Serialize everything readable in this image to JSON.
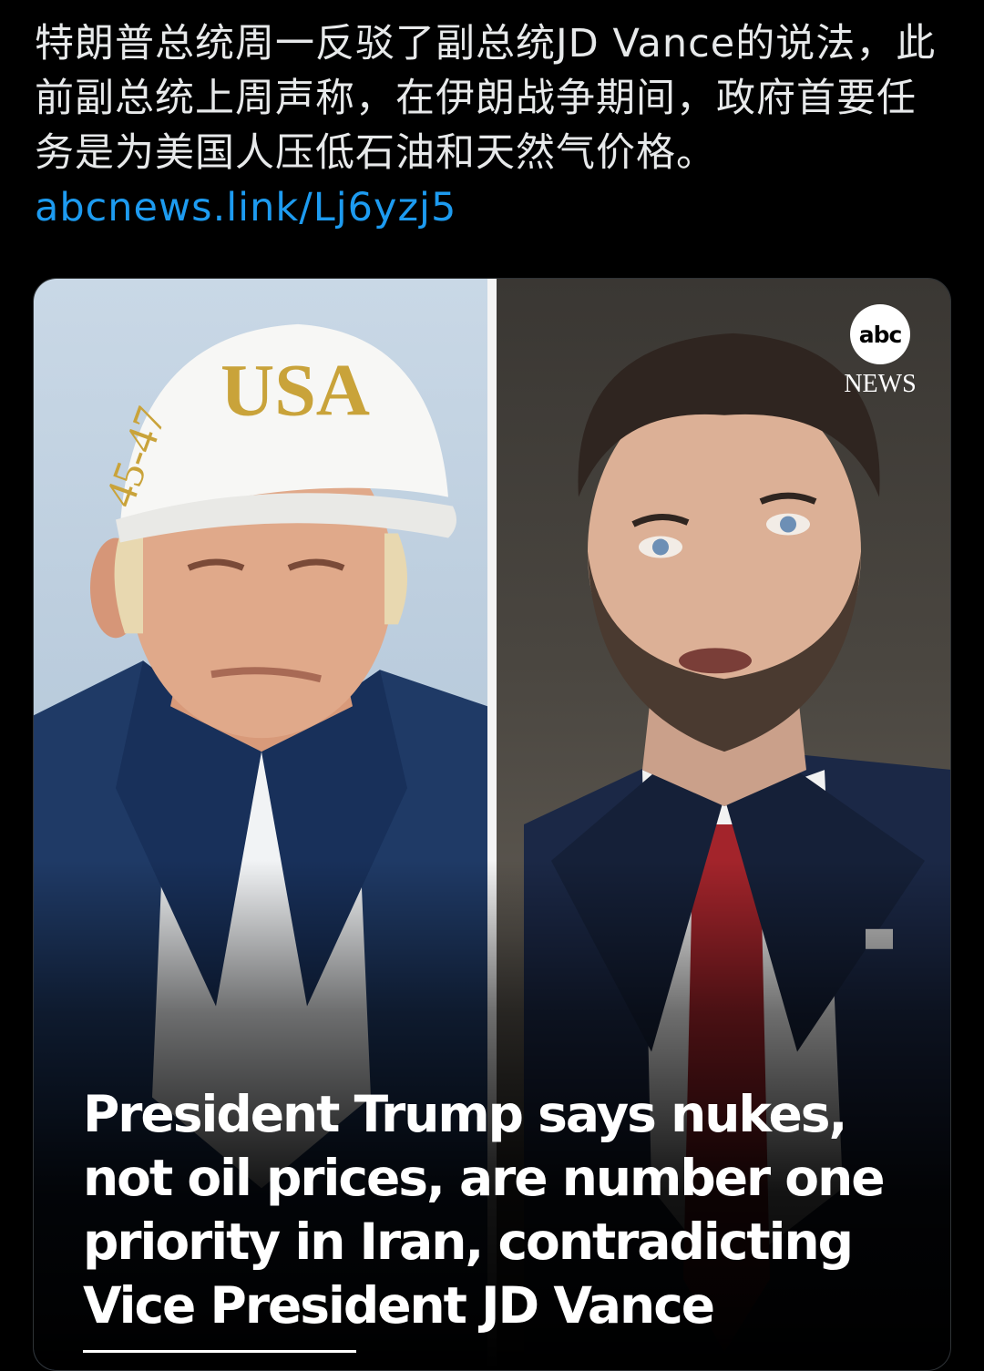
{
  "post": {
    "body_text": "特朗普总统周一反驳了副总统JD Vance的说法，此前副总统上周声称，在伊朗战争期间，政府首要任务是为美国人压低石油和天然气价格。",
    "link_text": "abcnews.link/Lj6yzj5"
  },
  "media": {
    "left_portrait": "trump-portrait",
    "right_portrait": "vance-portrait",
    "hat_text": "USA",
    "hat_side_text": "45-47",
    "logo": {
      "circle_text": "abc",
      "sub_text": "NEWS"
    },
    "headline": "President Trump says nukes, not oil prices, are number one priority in Iran, contradicting Vice President JD Vance"
  },
  "colors": {
    "background": "#000000",
    "text": "#e7e9ea",
    "link": "#1d9bf0",
    "headline": "#ffffff"
  }
}
